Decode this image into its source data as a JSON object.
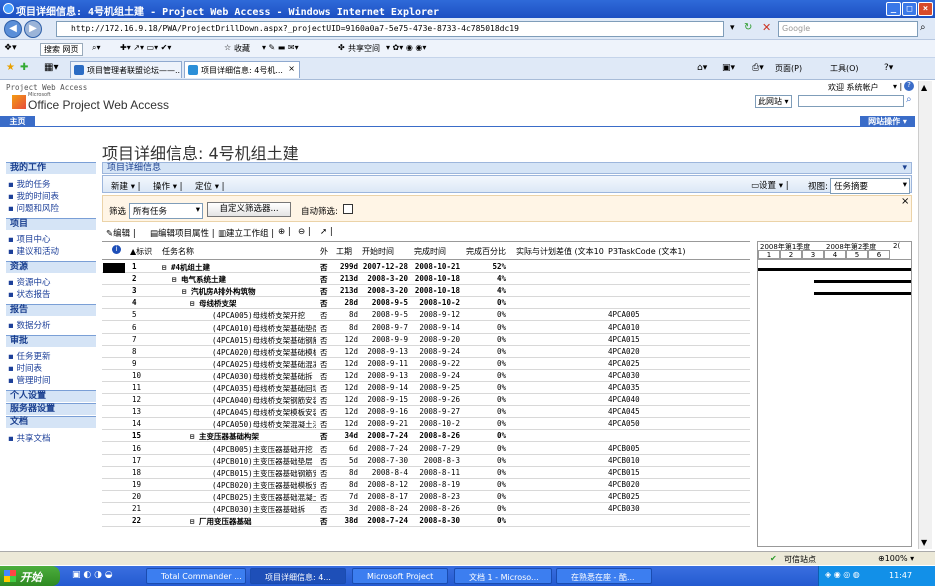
{
  "window": {
    "title": "项目详细信息: 4号机组土建 - Project Web Access - Windows Internet Explorer"
  },
  "address": {
    "url": "http://172.16.9.18/PWA/ProjectDrillDown.aspx?_projectUID=9160a0a7-5e75-473e-8733-4c785018dc19",
    "search_placeholder": "Google"
  },
  "toolbar1": {
    "search_label": "搜索 网页",
    "favorites": "收藏",
    "share": "共享空间"
  },
  "tabs": [
    {
      "label": "项目管理者联盟论坛——..."
    },
    {
      "label": "项目详细信息: 4号机..."
    }
  ],
  "ie_cmds": {
    "page": "页面(P)",
    "tools": "工具(O)"
  },
  "pwa": {
    "app_label": "Project Web Access",
    "logo_text": "Office Project Web Access",
    "logo_small": "Microsoft",
    "welcome": "欢迎 系统帐户",
    "scope": "此网站",
    "home_tab": "主页",
    "site_actions": "网站操作"
  },
  "page_title": "项目详细信息: 4号机组土建",
  "leftnav": {
    "sections": [
      {
        "title": "我的工作",
        "items": [
          "我的任务",
          "我的时间表",
          "问题和风险"
        ]
      },
      {
        "title": "项目",
        "items": [
          "项目中心",
          "建议和活动"
        ]
      },
      {
        "title": "资源",
        "items": [
          "资源中心",
          "状态报告"
        ]
      },
      {
        "title": "报告",
        "items": [
          "数据分析"
        ]
      },
      {
        "title": "审批",
        "items": [
          "任务更新",
          "时间表",
          "管理时间"
        ]
      },
      {
        "title": "个人设置",
        "items": []
      },
      {
        "title": "服务器设置",
        "items": []
      },
      {
        "title": "文档",
        "items": [
          "共享文档"
        ]
      }
    ]
  },
  "main": {
    "header": "项目详细信息",
    "actions": {
      "new": "新建",
      "actions": "操作",
      "goto": "定位",
      "settings": "设置",
      "view_label": "视图:",
      "view_value": "任务摘要"
    },
    "filter": {
      "label": "筛选",
      "value": "所有任务",
      "custom_btn": "自定义筛选器...",
      "auto_label": "自动筛选:"
    },
    "toolbar2": {
      "edit": "编辑",
      "edit_props": "编辑项目属性",
      "build_team": "建立工作组"
    },
    "columns": [
      "标识",
      "任务名称",
      "外",
      "工期",
      "开始时间",
      "完成时间",
      "完成百分比",
      "实际与计划差值 (文本10)",
      "P3TaskCode (文本1)"
    ],
    "rows": [
      {
        "id": "1",
        "name": "#4机组土建",
        "ext": "否",
        "dur": "299d",
        "start": "2007-12-28",
        "finish": "2008-10-21",
        "pct": "52%",
        "code": "",
        "lvl": 0,
        "summary": true
      },
      {
        "id": "2",
        "name": "电气系统土建",
        "ext": "否",
        "dur": "213d",
        "start": "2008-3-20",
        "finish": "2008-10-18",
        "pct": "4%",
        "code": "",
        "lvl": 1,
        "summary": true
      },
      {
        "id": "3",
        "name": "汽机房A排外构筑物",
        "ext": "否",
        "dur": "213d",
        "start": "2008-3-20",
        "finish": "2008-10-18",
        "pct": "4%",
        "code": "",
        "lvl": 2,
        "summary": true
      },
      {
        "id": "4",
        "name": "母线桥支架",
        "ext": "否",
        "dur": "28d",
        "start": "2008-9-5",
        "finish": "2008-10-2",
        "pct": "0%",
        "code": "",
        "lvl": 3,
        "summary": true
      },
      {
        "id": "5",
        "name": "(4PCA005)母线桥支架开挖",
        "ext": "否",
        "dur": "8d",
        "start": "2008-9-5",
        "finish": "2008-9-12",
        "pct": "0%",
        "code": "4PCA005",
        "lvl": 4,
        "summary": false
      },
      {
        "id": "6",
        "name": "(4PCA010)母线桥支架基础垫层",
        "ext": "否",
        "dur": "8d",
        "start": "2008-9-7",
        "finish": "2008-9-14",
        "pct": "0%",
        "code": "4PCA010",
        "lvl": 4,
        "summary": false
      },
      {
        "id": "7",
        "name": "(4PCA015)母线桥支架基础钢筋",
        "ext": "否",
        "dur": "12d",
        "start": "2008-9-9",
        "finish": "2008-9-20",
        "pct": "0%",
        "code": "4PCA015",
        "lvl": 4,
        "summary": false
      },
      {
        "id": "8",
        "name": "(4PCA020)母线桥支架基础模板",
        "ext": "否",
        "dur": "12d",
        "start": "2008-9-13",
        "finish": "2008-9-24",
        "pct": "0%",
        "code": "4PCA020",
        "lvl": 4,
        "summary": false
      },
      {
        "id": "9",
        "name": "(4PCA025)母线桥支架基础混凝",
        "ext": "否",
        "dur": "12d",
        "start": "2008-9-11",
        "finish": "2008-9-22",
        "pct": "0%",
        "code": "4PCA025",
        "lvl": 4,
        "summary": false
      },
      {
        "id": "10",
        "name": "(4PCA030)母线桥支架基础拆",
        "ext": "否",
        "dur": "12d",
        "start": "2008-9-13",
        "finish": "2008-9-24",
        "pct": "0%",
        "code": "4PCA030",
        "lvl": 4,
        "summary": false
      },
      {
        "id": "11",
        "name": "(4PCA035)母线桥支架基础回填",
        "ext": "否",
        "dur": "12d",
        "start": "2008-9-14",
        "finish": "2008-9-25",
        "pct": "0%",
        "code": "4PCA035",
        "lvl": 4,
        "summary": false
      },
      {
        "id": "12",
        "name": "(4PCA040)母线桥支架钢筋安装",
        "ext": "否",
        "dur": "12d",
        "start": "2008-9-15",
        "finish": "2008-9-26",
        "pct": "0%",
        "code": "4PCA040",
        "lvl": 4,
        "summary": false
      },
      {
        "id": "13",
        "name": "(4PCA045)母线桥支架模板安装",
        "ext": "否",
        "dur": "12d",
        "start": "2008-9-16",
        "finish": "2008-9-27",
        "pct": "0%",
        "code": "4PCA045",
        "lvl": 4,
        "summary": false
      },
      {
        "id": "14",
        "name": "(4PCA050)母线桥支架混凝土浇",
        "ext": "否",
        "dur": "12d",
        "start": "2008-9-21",
        "finish": "2008-10-2",
        "pct": "0%",
        "code": "4PCA050",
        "lvl": 4,
        "summary": false
      },
      {
        "id": "15",
        "name": "主变压器基础构架",
        "ext": "否",
        "dur": "34d",
        "start": "2008-7-24",
        "finish": "2008-8-26",
        "pct": "0%",
        "code": "",
        "lvl": 3,
        "summary": true
      },
      {
        "id": "16",
        "name": "(4PCB005)主变压器基础开挖",
        "ext": "否",
        "dur": "6d",
        "start": "2008-7-24",
        "finish": "2008-7-29",
        "pct": "0%",
        "code": "4PCB005",
        "lvl": 4,
        "summary": false
      },
      {
        "id": "17",
        "name": "(4PCB010)主变压器基础垫层",
        "ext": "否",
        "dur": "5d",
        "start": "2008-7-30",
        "finish": "2008-8-3",
        "pct": "0%",
        "code": "4PCB010",
        "lvl": 4,
        "summary": false
      },
      {
        "id": "18",
        "name": "(4PCB015)主变压器基础钢筋安",
        "ext": "否",
        "dur": "8d",
        "start": "2008-8-4",
        "finish": "2008-8-11",
        "pct": "0%",
        "code": "4PCB015",
        "lvl": 4,
        "summary": false
      },
      {
        "id": "19",
        "name": "(4PCB020)主变压器基础模板安",
        "ext": "否",
        "dur": "8d",
        "start": "2008-8-12",
        "finish": "2008-8-19",
        "pct": "0%",
        "code": "4PCB020",
        "lvl": 4,
        "summary": false
      },
      {
        "id": "20",
        "name": "(4PCB025)主变压器基础混凝土",
        "ext": "否",
        "dur": "7d",
        "start": "2008-8-17",
        "finish": "2008-8-23",
        "pct": "0%",
        "code": "4PCB025",
        "lvl": 4,
        "summary": false
      },
      {
        "id": "21",
        "name": "(4PCB030)主变压器基础拆",
        "ext": "否",
        "dur": "3d",
        "start": "2008-8-24",
        "finish": "2008-8-26",
        "pct": "0%",
        "code": "4PCB030",
        "lvl": 4,
        "summary": false
      },
      {
        "id": "22",
        "name": "厂用变压器基础",
        "ext": "否",
        "dur": "38d",
        "start": "2008-7-24",
        "finish": "2008-8-30",
        "pct": "0%",
        "code": "",
        "lvl": 3,
        "summary": true
      }
    ],
    "gantt": {
      "q1": "2008年第1季度",
      "q2": "2008年第2季度",
      "q3": "2(",
      "months": [
        "1",
        "2",
        "3",
        "4",
        "5",
        "6"
      ]
    }
  },
  "statusbar": {
    "zone": "可信站点",
    "zoom": "100%"
  },
  "taskbar": {
    "start": "开始",
    "items": [
      "Total Commander ...",
      "项目详细信息: 4...",
      "Microsoft Project",
      "文档 1 - Microso...",
      "在熟悉在座 - 酷..."
    ],
    "time": "11:47"
  }
}
